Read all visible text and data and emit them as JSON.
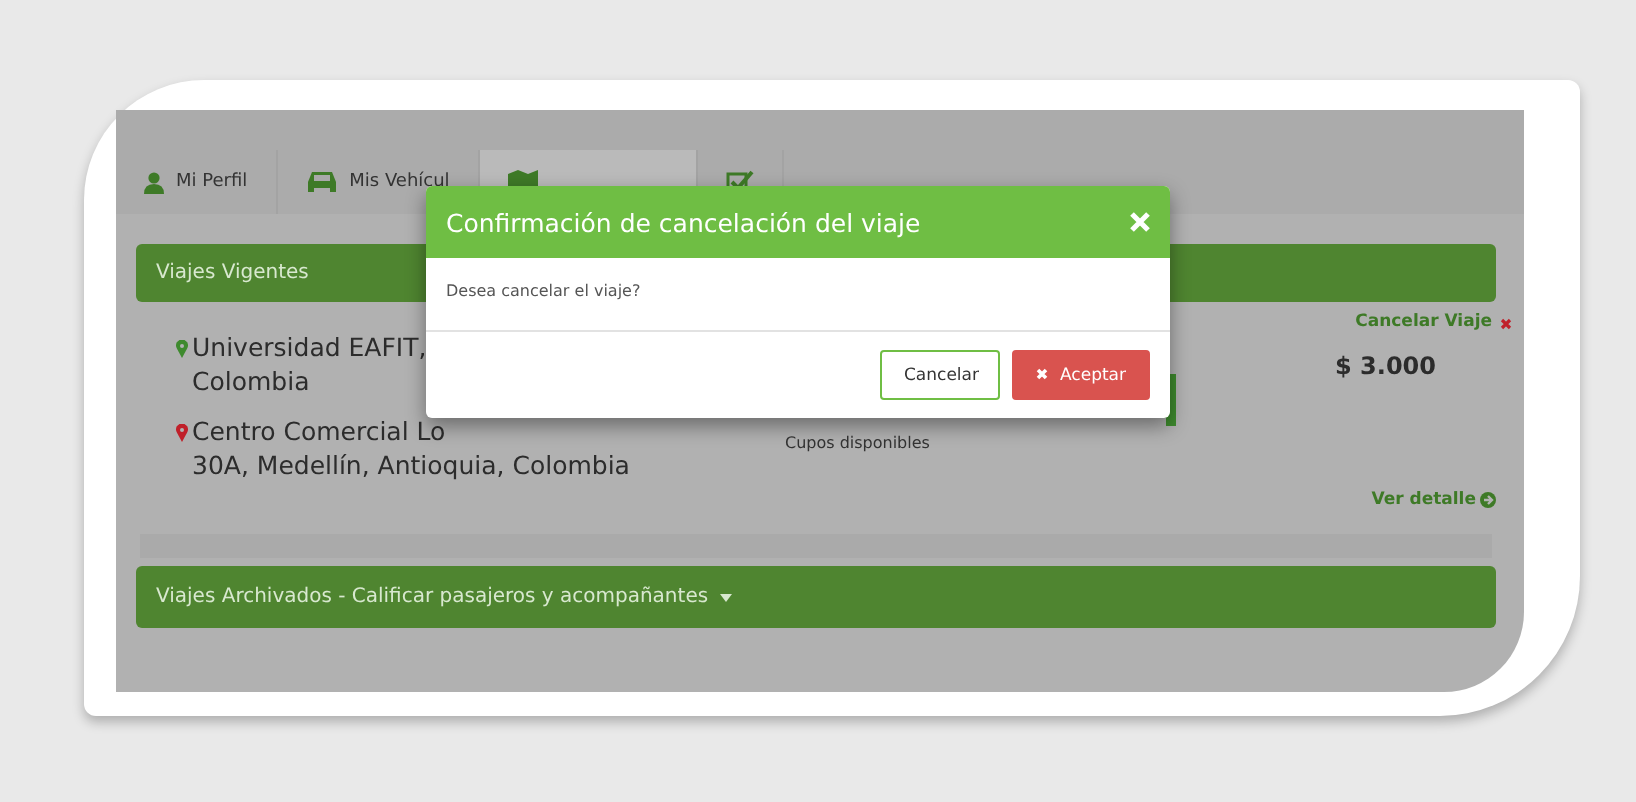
{
  "tabs": [
    {
      "label": "Mi Perfil",
      "selected": false
    },
    {
      "label": "Mis Vehícul",
      "selected": false
    },
    {
      "selected": true
    },
    {
      "selected": false
    }
  ],
  "current_trips": {
    "title": "Viajes Vigentes",
    "origin": [
      "Universidad EAFIT,",
      "Colombia"
    ],
    "destination": [
      "Centro Comercial Lo",
      "30A, Medellín, Antioquia, Colombia"
    ],
    "seats_label": "Cupos disponibles",
    "cancel_link": "Cancelar Viaje",
    "price": "$ 3.000",
    "detail_link": "Ver detalle"
  },
  "archived": {
    "title": "Viajes Archivados - Calificar pasajeros y acompañantes"
  },
  "dialog": {
    "title": "Confirmación de cancelación del viaje",
    "message": "Desea cancelar el viaje?",
    "buttons": [
      {
        "label": "Cancelar",
        "kind": "secondary"
      },
      {
        "label": "Aceptar",
        "kind": "danger"
      }
    ]
  }
}
